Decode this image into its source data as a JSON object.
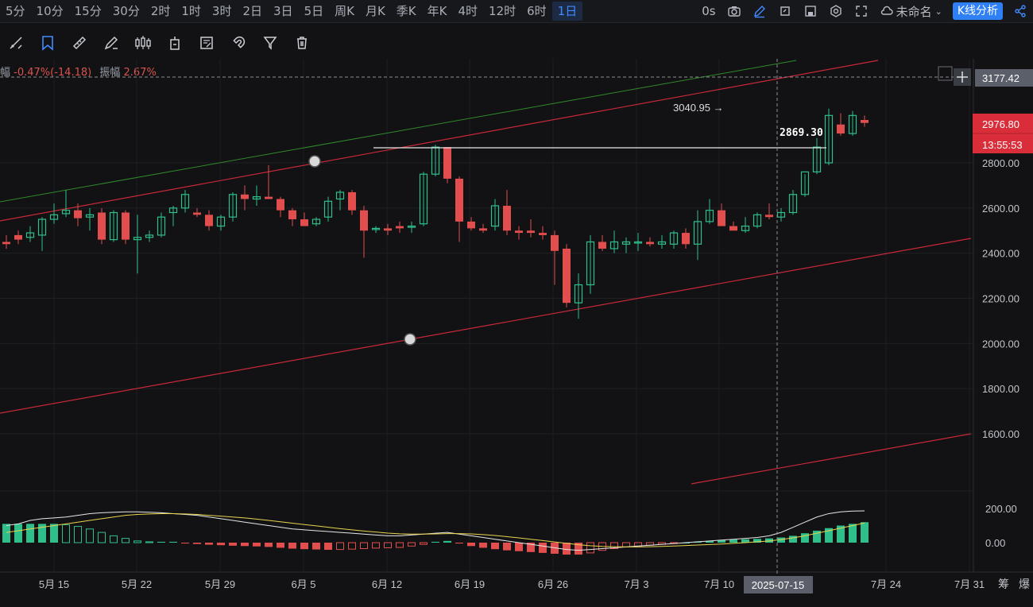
{
  "timeframes": [
    "5分",
    "10分",
    "15分",
    "30分",
    "2时",
    "1时",
    "3时",
    "2日",
    "3日",
    "5日",
    "周K",
    "月K",
    "季K",
    "年K",
    "4时",
    "12时",
    "6时",
    "1日"
  ],
  "active_timeframe": "1日",
  "topright": {
    "delay": "0s",
    "workspace_name": "未命名",
    "analysis_button": "K线分析"
  },
  "info": {
    "prefix_label": "幅",
    "change": "-0.47%(-14.18)",
    "amplitude_label": "振幅",
    "amplitude": "2.67%"
  },
  "price_axis": {
    "ticks": [
      "2800.00",
      "2600.00",
      "2400.00",
      "2200.00",
      "2000.00",
      "1800.00",
      "1600.00"
    ],
    "crosshair_price": "3177.42",
    "last_price": "2976.80",
    "countdown": "13:55:53"
  },
  "annotations": {
    "high_label": "3040.95 →",
    "hline_label": "2869.30"
  },
  "macd_axis": {
    "ticks": [
      "200.00",
      "0.00"
    ]
  },
  "time_axis": {
    "ticks": [
      "5月 15",
      "5月 22",
      "5月 29",
      "6月 5",
      "6月 12",
      "6月 19",
      "6月 26",
      "7月 3",
      "7月 10",
      "7月 24",
      "7月 31"
    ],
    "crosshair_date": "2025-07-15",
    "right_labels": [
      "筹",
      "爆"
    ]
  },
  "chart_data": {
    "type": "candlestick",
    "symbol_unit": "price",
    "ylim": [
      1500,
      3250
    ],
    "candles": [
      [
        2450,
        2480,
        2420,
        2440
      ],
      [
        2480,
        2500,
        2440,
        2460
      ],
      [
        2470,
        2520,
        2450,
        2490
      ],
      [
        2480,
        2560,
        2410,
        2550
      ],
      [
        2550,
        2620,
        2530,
        2570
      ],
      [
        2575,
        2680,
        2560,
        2590
      ],
      [
        2590,
        2620,
        2520,
        2555
      ],
      [
        2560,
        2600,
        2500,
        2570
      ],
      [
        2580,
        2600,
        2440,
        2460
      ],
      [
        2460,
        2590,
        2450,
        2580
      ],
      [
        2580,
        2590,
        2440,
        2460
      ],
      [
        2460,
        2570,
        2310,
        2470
      ],
      [
        2470,
        2500,
        2450,
        2480
      ],
      [
        2480,
        2580,
        2470,
        2560
      ],
      [
        2580,
        2610,
        2520,
        2600
      ],
      [
        2600,
        2680,
        2580,
        2660
      ],
      [
        2580,
        2600,
        2560,
        2570
      ],
      [
        2570,
        2590,
        2500,
        2520
      ],
      [
        2520,
        2570,
        2500,
        2560
      ],
      [
        2560,
        2670,
        2540,
        2660
      ],
      [
        2660,
        2700,
        2590,
        2640
      ],
      [
        2640,
        2700,
        2610,
        2650
      ],
      [
        2650,
        2790,
        2640,
        2640
      ],
      [
        2640,
        2650,
        2560,
        2590
      ],
      [
        2590,
        2600,
        2520,
        2550
      ],
      [
        2550,
        2580,
        2520,
        2520
      ],
      [
        2530,
        2560,
        2520,
        2550
      ],
      [
        2560,
        2650,
        2540,
        2630
      ],
      [
        2640,
        2680,
        2590,
        2670
      ],
      [
        2670,
        2680,
        2570,
        2590
      ],
      [
        2590,
        2610,
        2380,
        2500
      ],
      [
        2510,
        2520,
        2490,
        2510
      ],
      [
        2510,
        2530,
        2480,
        2500
      ],
      [
        2520,
        2540,
        2490,
        2510
      ],
      [
        2520,
        2540,
        2490,
        2520
      ],
      [
        2530,
        2760,
        2520,
        2750
      ],
      [
        2750,
        2880,
        2740,
        2870
      ],
      [
        2870,
        2870,
        2710,
        2730
      ],
      [
        2730,
        2740,
        2450,
        2540
      ],
      [
        2540,
        2560,
        2500,
        2510
      ],
      [
        2510,
        2530,
        2490,
        2500
      ],
      [
        2520,
        2640,
        2500,
        2610
      ],
      [
        2610,
        2680,
        2480,
        2500
      ],
      [
        2500,
        2520,
        2460,
        2490
      ],
      [
        2500,
        2550,
        2470,
        2490
      ],
      [
        2490,
        2520,
        2460,
        2480
      ],
      [
        2480,
        2500,
        2260,
        2410
      ],
      [
        2420,
        2440,
        2160,
        2180
      ],
      [
        2180,
        2310,
        2110,
        2260
      ],
      [
        2260,
        2480,
        2220,
        2450
      ],
      [
        2450,
        2480,
        2410,
        2420
      ],
      [
        2420,
        2500,
        2400,
        2450
      ],
      [
        2440,
        2470,
        2400,
        2450
      ],
      [
        2450,
        2490,
        2410,
        2450
      ],
      [
        2450,
        2470,
        2430,
        2440
      ],
      [
        2440,
        2480,
        2420,
        2450
      ],
      [
        2440,
        2500,
        2420,
        2490
      ],
      [
        2490,
        2510,
        2420,
        2440
      ],
      [
        2440,
        2590,
        2370,
        2540
      ],
      [
        2540,
        2640,
        2530,
        2590
      ],
      [
        2590,
        2620,
        2520,
        2520
      ],
      [
        2520,
        2540,
        2500,
        2500
      ],
      [
        2500,
        2560,
        2490,
        2520
      ],
      [
        2520,
        2580,
        2510,
        2570
      ],
      [
        2570,
        2620,
        2550,
        2560
      ],
      [
        2560,
        2600,
        2540,
        2580
      ],
      [
        2580,
        2680,
        2570,
        2660
      ],
      [
        2660,
        2750,
        2650,
        2760
      ],
      [
        2760,
        2910,
        2750,
        2870
      ],
      [
        2800,
        3040,
        2790,
        3010
      ],
      [
        2970,
        3020,
        2920,
        2930
      ],
      [
        2930,
        3030,
        2920,
        3010
      ],
      [
        2990,
        3010,
        2960,
        2977
      ]
    ],
    "macd_hist": [
      110,
      110,
      110,
      110,
      110,
      105,
      95,
      80,
      60,
      40,
      25,
      10,
      5,
      5,
      5,
      -5,
      -8,
      -12,
      -15,
      -18,
      -20,
      -22,
      -25,
      -30,
      -35,
      -38,
      -40,
      -42,
      -40,
      -38,
      -35,
      -32,
      -30,
      -28,
      -20,
      -10,
      5,
      10,
      -5,
      -20,
      -30,
      -38,
      -45,
      -50,
      -55,
      -60,
      -65,
      -70,
      -70,
      -60,
      -45,
      -35,
      -25,
      -20,
      -15,
      -10,
      -5,
      0,
      5,
      10,
      15,
      18,
      20,
      22,
      25,
      30,
      40,
      55,
      70,
      85,
      100,
      110,
      120
    ],
    "macd_dif": [
      100,
      110,
      130,
      140,
      145,
      150,
      160,
      170,
      175,
      178,
      180,
      180,
      178,
      175,
      170,
      165,
      160,
      150,
      140,
      130,
      120,
      110,
      100,
      90,
      80,
      75,
      70,
      65,
      60,
      55,
      50,
      45,
      40,
      40,
      45,
      50,
      55,
      60,
      50,
      40,
      30,
      20,
      10,
      0,
      -10,
      -20,
      -30,
      -40,
      -45,
      -40,
      -35,
      -30,
      -25,
      -20,
      -15,
      -10,
      -5,
      0,
      5,
      10,
      15,
      20,
      25,
      30,
      40,
      60,
      90,
      120,
      150,
      170,
      180,
      185,
      186
    ],
    "macd_dea": [
      60,
      70,
      80,
      90,
      100,
      110,
      120,
      130,
      140,
      150,
      160,
      165,
      168,
      170,
      170,
      168,
      165,
      160,
      155,
      150,
      145,
      138,
      130,
      122,
      114,
      106,
      98,
      90,
      82,
      75,
      68,
      62,
      56,
      52,
      50,
      50,
      51,
      53,
      53,
      51,
      47,
      42,
      35,
      28,
      20,
      12,
      4,
      -4,
      -12,
      -18,
      -22,
      -24,
      -25,
      -25,
      -24,
      -22,
      -20,
      -17,
      -14,
      -11,
      -8,
      -4,
      0,
      5,
      10,
      18,
      28,
      40,
      55,
      70,
      85,
      100,
      115
    ]
  }
}
